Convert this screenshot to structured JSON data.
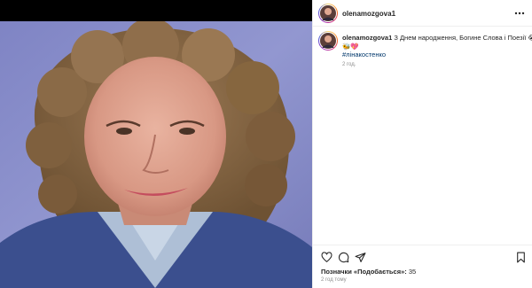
{
  "post": {
    "username": "olenamozgova1",
    "caption_text": "З Днем народження, Богине Слова і Поезії",
    "caption_emoji_1": "😭",
    "caption_emoji_2": "🐝💖",
    "hashtag": "#лінакостенко",
    "caption_time": "2 год.",
    "likes_prefix": "Позначки «Подобається»:",
    "likes_count": "35",
    "posted_time": "2 год тому"
  },
  "icons": {
    "more": "more-horizontal-icon",
    "like": "heart-icon",
    "comment": "comment-icon",
    "share": "share-icon",
    "save": "bookmark-icon"
  },
  "colors": {
    "link": "#00376b",
    "muted": "#8e8e8e",
    "text": "#262626",
    "photo_bg": "#8e93c9"
  }
}
